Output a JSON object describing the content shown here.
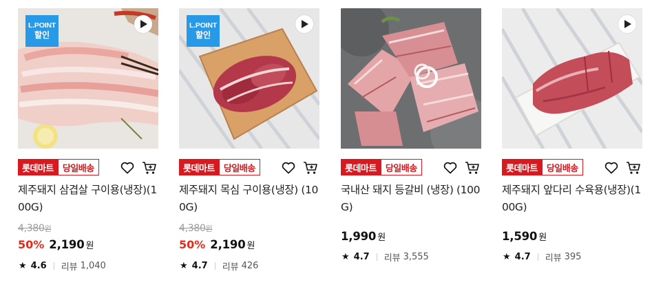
{
  "products": [
    {
      "lpoint": {
        "line1": "L.POINT",
        "line2": "할인"
      },
      "badge_mart": "롯데마트",
      "badge_delivery": "당일배송",
      "name": "제주돼지 삼겹살 구이용(냉장)(100G)",
      "original_price": "4,380",
      "original_unit": "원",
      "discount": "50%",
      "price": "2,190",
      "price_unit": "원",
      "rating": "4.6",
      "review_label": "리뷰",
      "review_count": "1,040"
    },
    {
      "lpoint": {
        "line1": "L.POINT",
        "line2": "할인"
      },
      "badge_mart": "롯데마트",
      "badge_delivery": "당일배송",
      "name": "제주돼지 목심 구이용(냉장) (100G)",
      "original_price": "4,380",
      "original_unit": "원",
      "discount": "50%",
      "price": "2,190",
      "price_unit": "원",
      "rating": "4.7",
      "review_label": "리뷰",
      "review_count": "426"
    },
    {
      "badge_mart": "롯데마트",
      "badge_delivery": "당일배송",
      "name": "국내산 돼지 등갈비 (냉장) (100G)",
      "price": "1,990",
      "price_unit": "원",
      "rating": "4.7",
      "review_label": "리뷰",
      "review_count": "3,555"
    },
    {
      "badge_mart": "롯데마트",
      "badge_delivery": "당일배송",
      "name": "제주돼지 앞다리 수육용(냉장)(100G)",
      "price": "1,590",
      "price_unit": "원",
      "rating": "4.7",
      "review_label": "리뷰",
      "review_count": "395"
    }
  ],
  "icons": {
    "play": "play-icon",
    "heart": "heart-icon",
    "cart": "cart-icon",
    "star": "star-icon"
  },
  "colors": {
    "brand_red": "#d71920",
    "discount_red": "#e32b1c",
    "lpoint_blue": "#2899e6"
  }
}
